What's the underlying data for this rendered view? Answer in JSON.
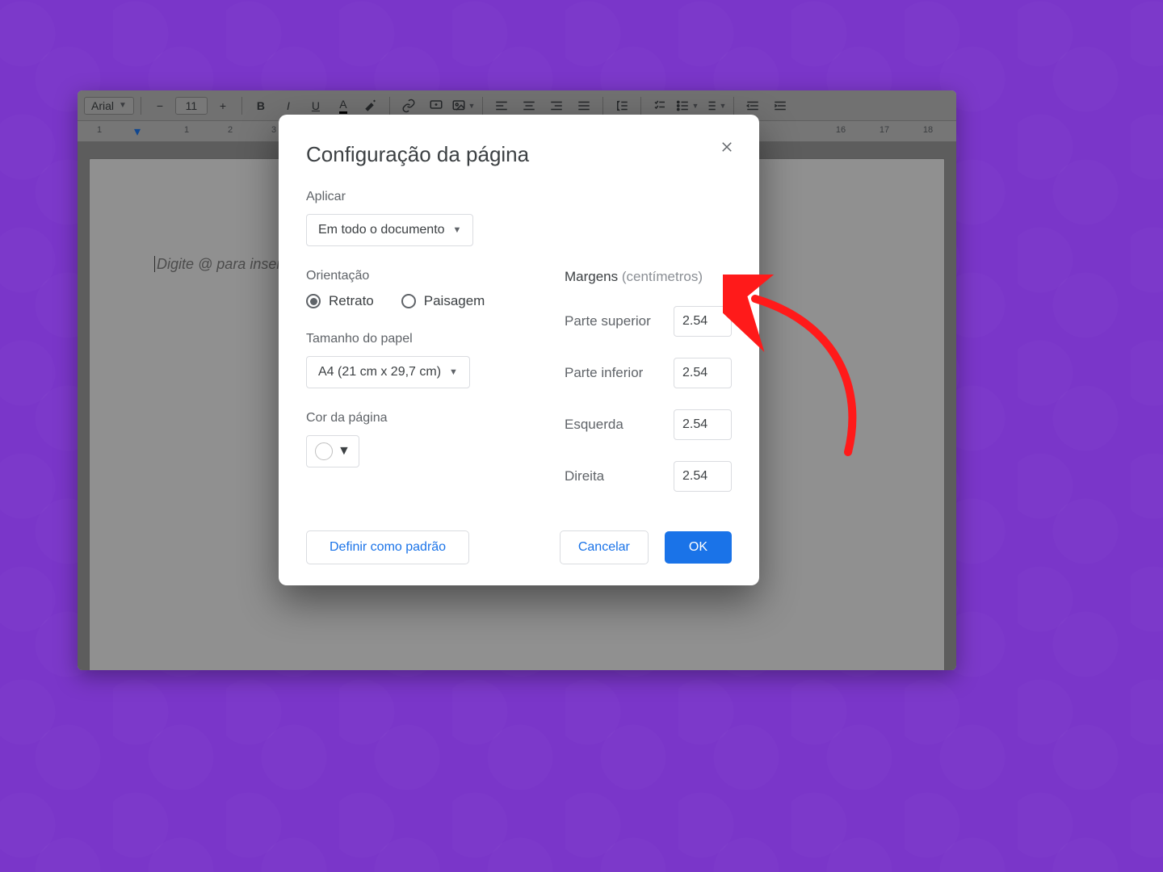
{
  "toolbar": {
    "font_name": "Arial",
    "font_size": "11"
  },
  "ruler": {
    "numbers": [
      "1",
      "",
      "1",
      "2",
      "3",
      "",
      "",
      "",
      "",
      "",
      "",
      "",
      "",
      "",
      "",
      "",
      "",
      "16",
      "17",
      "18"
    ]
  },
  "page": {
    "placeholder": "Digite @ para inser"
  },
  "dialog": {
    "title": "Configuração da página",
    "apply_label": "Aplicar",
    "apply_value": "Em todo o documento",
    "orientation_label": "Orientação",
    "orientation_portrait": "Retrato",
    "orientation_landscape": "Paisagem",
    "paper_label": "Tamanho do papel",
    "paper_value": "A4 (21 cm x 29,7 cm)",
    "pagecolor_label": "Cor da página",
    "margins_label": "Margens",
    "margins_unit": "(centímetros)",
    "margin_top_label": "Parte superior",
    "margin_top_value": "2.54",
    "margin_bottom_label": "Parte inferior",
    "margin_bottom_value": "2.54",
    "margin_left_label": "Esquerda",
    "margin_left_value": "2.54",
    "margin_right_label": "Direita",
    "margin_right_value": "2.54",
    "set_default": "Definir como padrão",
    "cancel": "Cancelar",
    "ok": "OK"
  }
}
